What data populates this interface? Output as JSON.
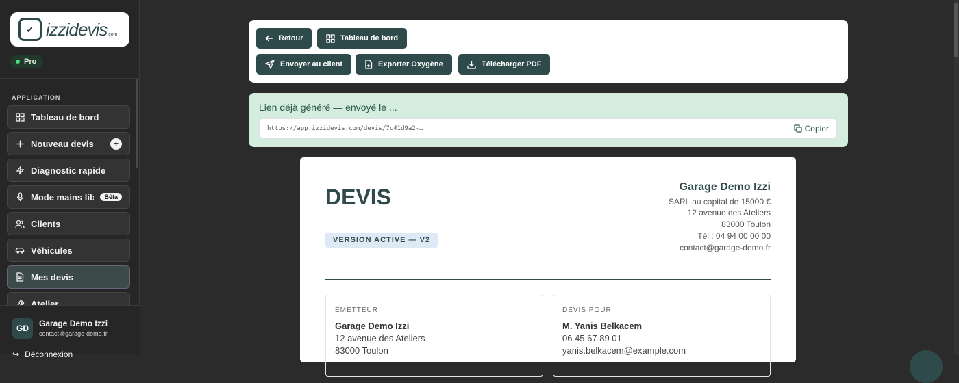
{
  "brand": {
    "logo_text": "izzidevis",
    "logo_suffix": ".com",
    "plan_badge": "Pro"
  },
  "sidebar": {
    "section_label": "APPLICATION",
    "items": [
      {
        "label": "Tableau de bord",
        "icon": "grid-icon"
      },
      {
        "label": "Nouveau devis",
        "icon": "plus-icon",
        "badge": "+"
      },
      {
        "label": "Diagnostic rapide",
        "icon": "bolt-icon"
      },
      {
        "label": "Mode mains libres",
        "icon": "microphone-icon",
        "badge": "Bêta"
      },
      {
        "label": "Clients",
        "icon": "users-icon"
      },
      {
        "label": "Véhicules",
        "icon": "car-icon"
      },
      {
        "label": "Mes devis",
        "icon": "document-icon",
        "active": true
      },
      {
        "label": "Atelier",
        "icon": "wrench-icon"
      }
    ],
    "user": {
      "initials": "GD",
      "name": "Garage Demo Izzi",
      "email": "contact@garage-demo.fr"
    },
    "logout_label": "Déconnexion"
  },
  "toolbar": {
    "back_label": "Retour",
    "dashboard_label": "Tableau de bord",
    "send_label": "Envoyer au client",
    "export_label": "Exporter Oxygène",
    "download_label": "Télécharger PDF"
  },
  "share_link": {
    "title": "Lien déjà généré — envoyé le ...",
    "url": "https://app.izzidevis.com/devis/7c41d9a2-…",
    "copy_label": "Copier"
  },
  "document": {
    "title": "DEVIS",
    "version_badge": "VERSION ACTIVE — V2",
    "company": {
      "name": "Garage Demo Izzi",
      "legal": "SARL au capital de 15000 €",
      "address": "12 avenue des Ateliers",
      "city": "83000 Toulon",
      "phone": "Tél : 04 94 00 00 00",
      "email": "contact@garage-demo.fr"
    },
    "issuer": {
      "label": "ÉMETTEUR",
      "name": "Garage Demo Izzi",
      "address": "12 avenue des Ateliers",
      "city": "83000 Toulon"
    },
    "recipient": {
      "label": "DEVIS POUR",
      "name": "M. Yanis Belkacem",
      "phone": "06 45 67 89 01",
      "email": "yanis.belkacem@example.com"
    }
  },
  "colors": {
    "accent": "#2f4a4a",
    "success_bg": "#d4eddf",
    "background": "#2b2b2b"
  }
}
